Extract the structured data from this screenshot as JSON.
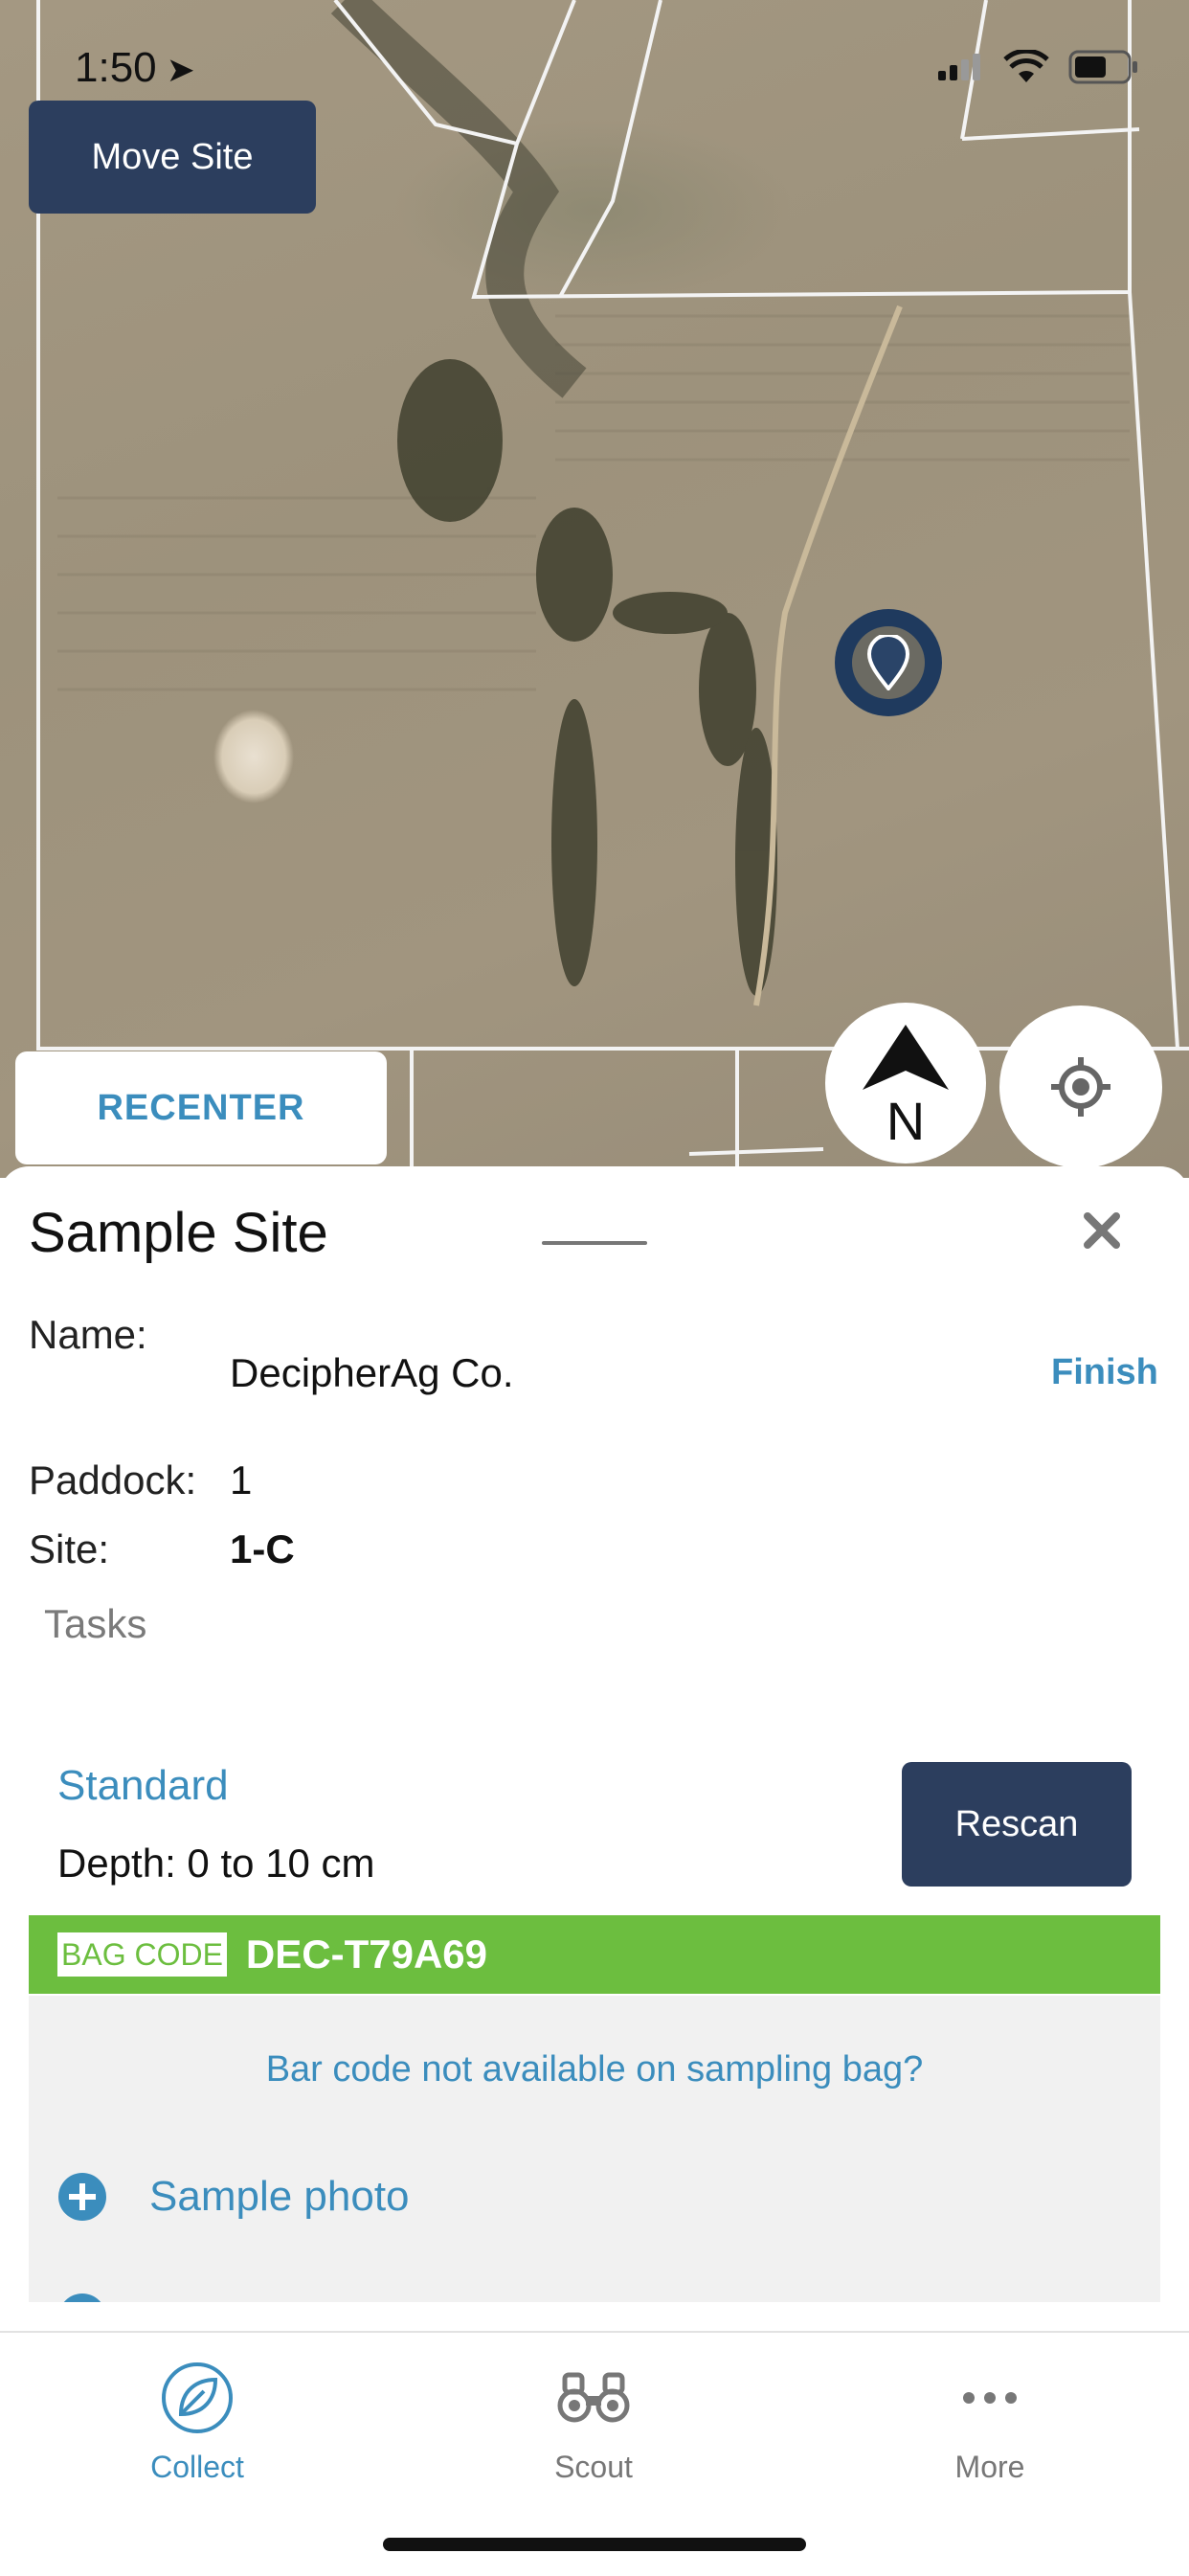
{
  "status_bar": {
    "time": "1:50"
  },
  "map": {
    "move_site_label": "Move Site",
    "recenter_label": "RECENTER",
    "compass_letter": "N"
  },
  "sheet": {
    "title": "Sample Site",
    "name_label": "Name:",
    "name_value": "DecipherAg Co.",
    "finish_label": "Finish",
    "paddock_label": "Paddock:",
    "paddock_value": "1",
    "site_label": "Site:",
    "site_value": "1-C",
    "tasks_label": "Tasks",
    "task": {
      "name": "Standard",
      "depth": "Depth: 0 to 10 cm",
      "rescan_label": "Rescan",
      "bag_code_chip": "BAG CODE",
      "bag_code_value": "DEC-T79A69",
      "barcode_link": "Bar code not available on sampling bag?",
      "sample_photo_label": "Sample photo"
    }
  },
  "tabbar": {
    "tabs": [
      {
        "label": "Collect",
        "icon": "leaf-icon",
        "active": true
      },
      {
        "label": "Scout",
        "icon": "binoculars-icon",
        "active": false
      },
      {
        "label": "More",
        "icon": "more-dots-icon",
        "active": false
      }
    ]
  },
  "colors": {
    "navy": "#2c3e5e",
    "accent_blue": "#3b8dbd",
    "bag_green": "#6cbe3f"
  }
}
